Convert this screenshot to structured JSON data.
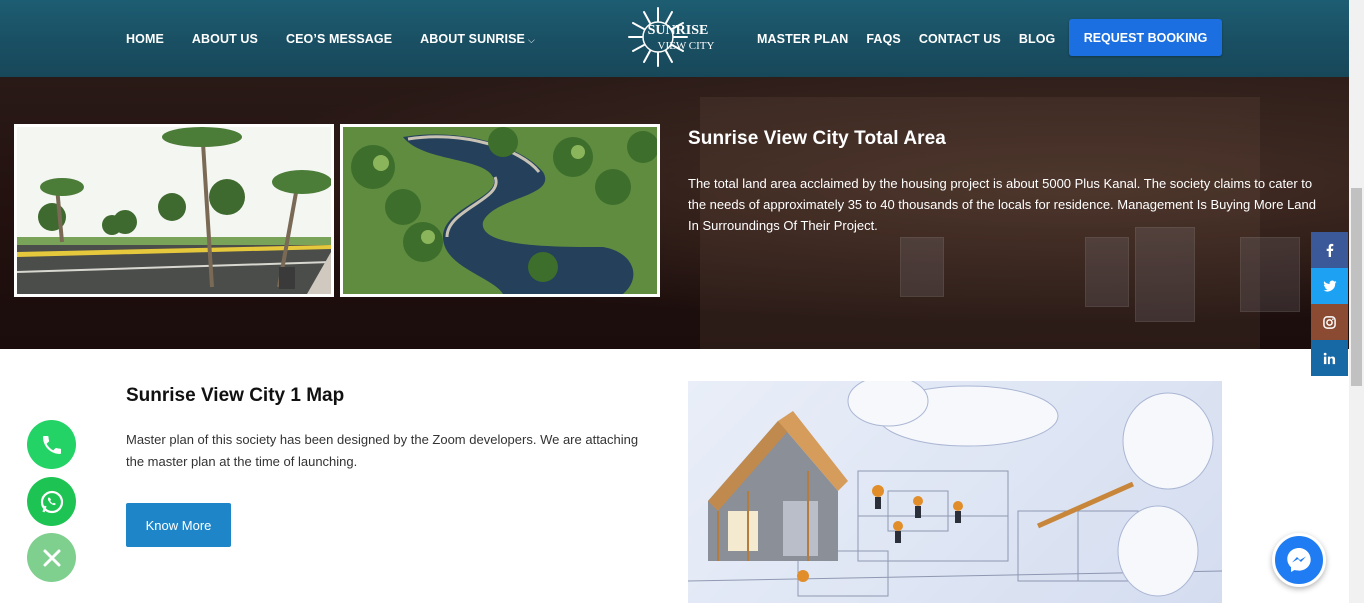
{
  "nav": {
    "left": [
      "HOME",
      "ABOUT US",
      "CEO’S MESSAGE",
      "ABOUT SUNRISE"
    ],
    "right": [
      "MASTER PLAN",
      "FAQS",
      "CONTACT US",
      "BLOG"
    ],
    "dropdown_icon": "chevron-down-icon",
    "booking_button": "REQUEST BOOKING",
    "logo_line1": "SUNRISE",
    "logo_line2": "VIEW CITY"
  },
  "area": {
    "title": "Sunrise View City Total Area",
    "text": "The total land area acclaimed by the housing project is about 5000 Plus Kanal. The society claims to cater to the needs of approximately 35 to 40 thousands of the locals for residence. Management Is Buying More Land In Surroundings Of Their Project."
  },
  "map": {
    "title": "Sunrise View City 1 Map",
    "text": "Master plan of this society has been designed by the Zoom developers. We are attaching the master plan at the time of launching.",
    "button": "Know More"
  },
  "social": [
    "facebook-icon",
    "twitter-icon",
    "instagram-icon",
    "linkedin-icon"
  ],
  "colors": {
    "header": "#1a4f63",
    "booking": "#1b6fe0",
    "know_more": "#1e86c8",
    "facebook": "#3b5998",
    "twitter": "#1da1f2",
    "instagram": "#8a4b32",
    "linkedin": "#1769a6",
    "whatsapp": "#23d366",
    "messenger": "#1f7cf2"
  }
}
